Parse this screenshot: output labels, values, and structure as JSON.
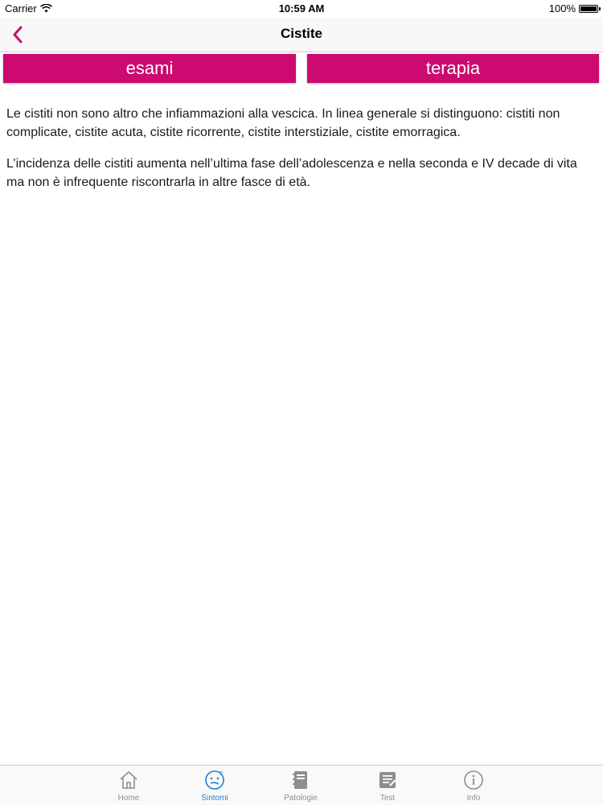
{
  "status_bar": {
    "carrier": "Carrier",
    "time": "10:59 AM",
    "battery": "100%"
  },
  "nav": {
    "title": "Cistite",
    "back_icon": "chevron-left-icon",
    "accent_color": "#cc0a6f"
  },
  "buttons": {
    "esami": "esami",
    "terapia": "terapia"
  },
  "content": {
    "paragraphs": [
      "Le cistiti non sono altro che infiammazioni alla vescica. In linea generale si distinguono: cistiti non complicate, cistite acuta, cistite ricorrente, cistite interstiziale, cistite emorragica.",
      "L’incidenza delle cistiti aumenta nell’ultima fase dell’adolescenza e nella seconda e IV decade di vita ma non è infrequente riscontrarla in altre fasce di età."
    ]
  },
  "tab_bar": {
    "active_color": "#1c7fd6",
    "items": [
      {
        "label": "Home",
        "icon": "home-icon"
      },
      {
        "label": "Sintomi",
        "icon": "confused-face-icon",
        "active": true
      },
      {
        "label": "Patologie",
        "icon": "notebook-icon"
      },
      {
        "label": "Test",
        "icon": "checklist-icon"
      },
      {
        "label": "Info",
        "icon": "info-icon"
      }
    ]
  }
}
